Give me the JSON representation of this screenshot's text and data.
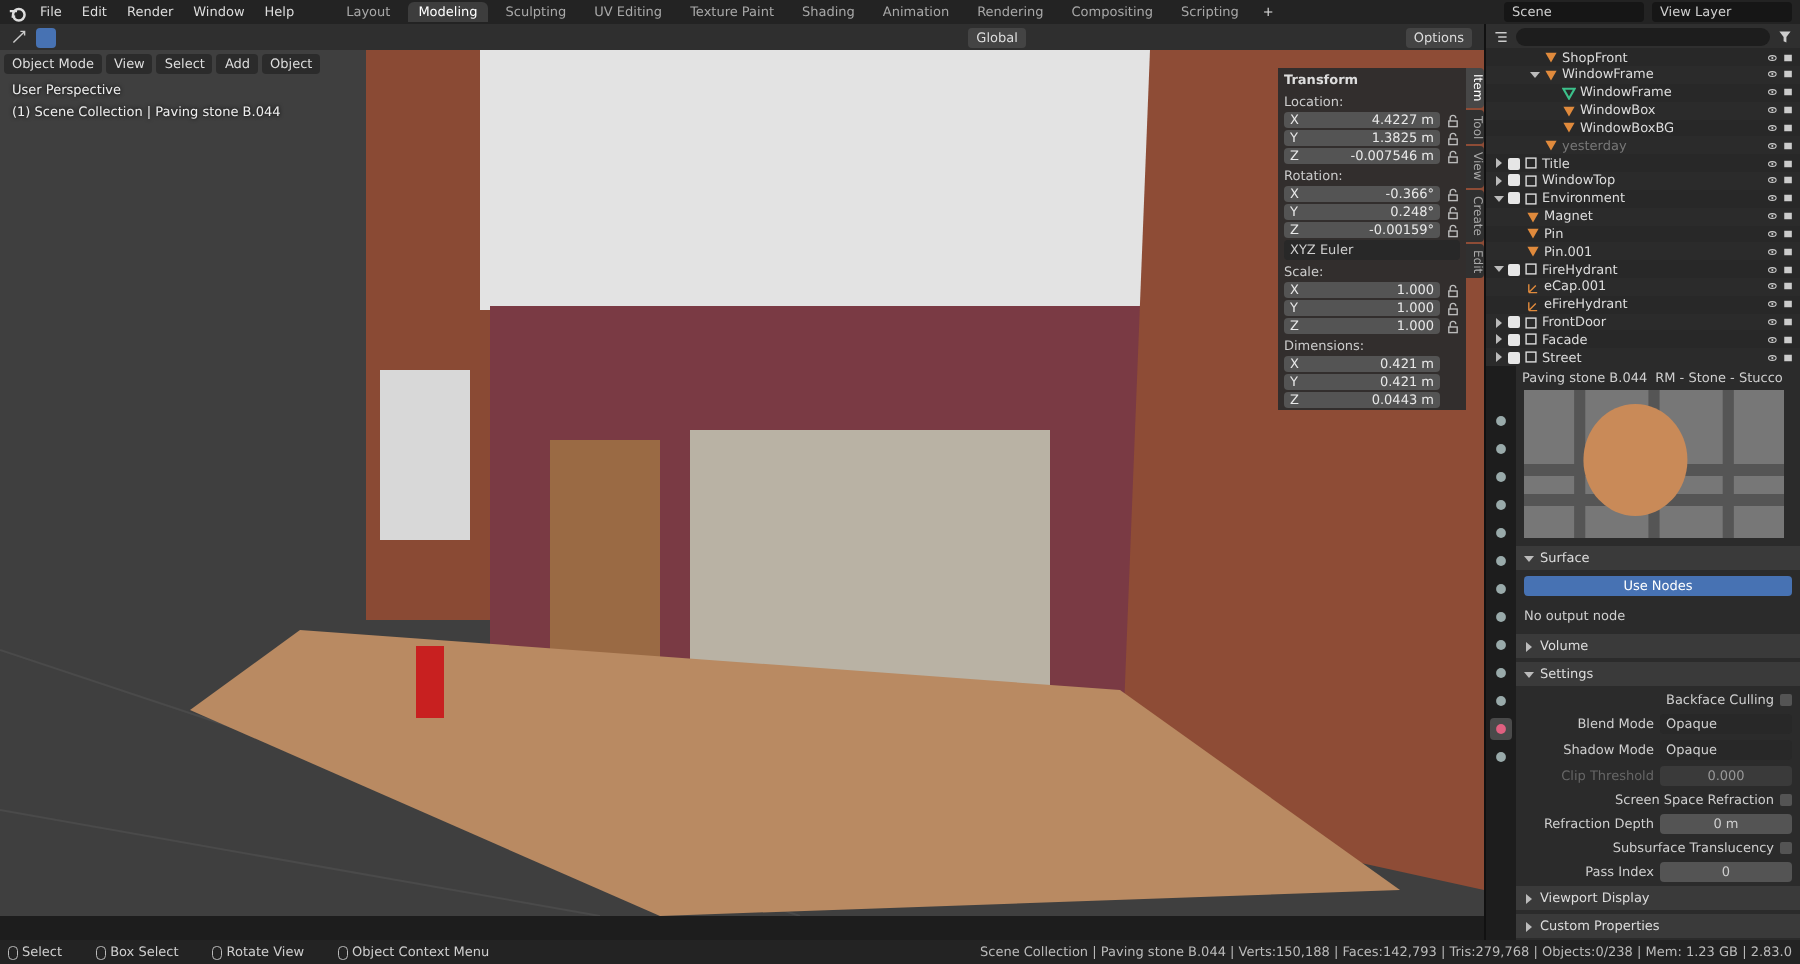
{
  "menu": [
    "File",
    "Edit",
    "Render",
    "Window",
    "Help"
  ],
  "workspaces": [
    {
      "label": "Layout",
      "selected": false
    },
    {
      "label": "Modeling",
      "selected": true
    },
    {
      "label": "Sculpting",
      "selected": false
    },
    {
      "label": "UV Editing",
      "selected": false
    },
    {
      "label": "Texture Paint",
      "selected": false
    },
    {
      "label": "Shading",
      "selected": false
    },
    {
      "label": "Animation",
      "selected": false
    },
    {
      "label": "Rendering",
      "selected": false
    },
    {
      "label": "Compositing",
      "selected": false
    },
    {
      "label": "Scripting",
      "selected": false
    }
  ],
  "add_workspace": "+",
  "scene": "Scene",
  "view_layer": "View Layer",
  "tool_header": {
    "orientation": "Global",
    "options": "Options"
  },
  "viewport": {
    "mode": "Object Mode",
    "menus": [
      "View",
      "Select",
      "Add",
      "Object"
    ],
    "info": [
      "User Perspective",
      "(1) Scene Collection | Paving stone B.044"
    ]
  },
  "sidebar": {
    "tabs": [
      {
        "label": "Item",
        "selected": true
      },
      {
        "label": "Tool",
        "selected": false
      },
      {
        "label": "View",
        "selected": false
      },
      {
        "label": "Create",
        "selected": false
      },
      {
        "label": "Edit",
        "selected": false
      }
    ],
    "title": "Transform",
    "groups": [
      {
        "label": "Location:",
        "fields": [
          {
            "axis": "X",
            "value": "4.4227 m"
          },
          {
            "axis": "Y",
            "value": "1.3825 m"
          },
          {
            "axis": "Z",
            "value": "-0.007546 m"
          }
        ],
        "locks": true
      },
      {
        "label": "Rotation:",
        "fields": [
          {
            "axis": "X",
            "value": "-0.366°"
          },
          {
            "axis": "Y",
            "value": "0.248°"
          },
          {
            "axis": "Z",
            "value": "-0.00159°"
          }
        ],
        "locks": true,
        "mode": "XYZ Euler"
      },
      {
        "label": "Scale:",
        "fields": [
          {
            "axis": "X",
            "value": "1.000"
          },
          {
            "axis": "Y",
            "value": "1.000"
          },
          {
            "axis": "Z",
            "value": "1.000"
          }
        ],
        "locks": true
      },
      {
        "label": "Dimensions:",
        "fields": [
          {
            "axis": "X",
            "value": "0.421 m"
          },
          {
            "axis": "Y",
            "value": "0.421 m"
          },
          {
            "axis": "Z",
            "value": "0.0443 m"
          }
        ],
        "locks": false
      }
    ]
  },
  "outliner": {
    "continued_children": [
      {
        "label": "ShopFront",
        "kind": "object",
        "disabled": false
      },
      {
        "label": "WindowFrame",
        "kind": "object",
        "expanded": true,
        "disabled": false,
        "children": [
          {
            "label": "WindowFrame",
            "kind": "mesh",
            "disabled": false
          },
          {
            "label": "WindowBox",
            "kind": "object",
            "disabled": false
          },
          {
            "label": "WindowBoxBG",
            "kind": "object",
            "disabled": false
          }
        ]
      },
      {
        "label": "yesterday",
        "kind": "object",
        "disabled": true
      }
    ],
    "items": [
      {
        "label": "Title",
        "kind": "collection",
        "checked": true,
        "expanded": false,
        "disabled": false
      },
      {
        "label": "WindowTop",
        "kind": "collection",
        "checked": true,
        "expanded": false,
        "disabled": false
      },
      {
        "label": "Environment",
        "kind": "collection",
        "checked": true,
        "expanded": true,
        "disabled": false,
        "children": [
          {
            "label": "Magnet",
            "kind": "object",
            "disabled": false
          },
          {
            "label": "Pin",
            "kind": "object",
            "disabled": false
          },
          {
            "label": "Pin.001",
            "kind": "object",
            "disabled": false
          }
        ]
      },
      {
        "label": "FireHydrant",
        "kind": "collection",
        "checked": true,
        "expanded": true,
        "disabled": false,
        "children": [
          {
            "label": "eCap.001",
            "kind": "empty",
            "disabled": false
          },
          {
            "label": "eFireHydrant",
            "kind": "empty",
            "disabled": false
          }
        ]
      },
      {
        "label": "FrontDoor",
        "kind": "collection",
        "checked": true,
        "expanded": false,
        "disabled": false
      },
      {
        "label": "Facade",
        "kind": "collection",
        "checked": true,
        "expanded": false,
        "disabled": false
      },
      {
        "label": "Street",
        "kind": "collection",
        "checked": true,
        "expanded": false,
        "disabled": false
      }
    ]
  },
  "properties": {
    "object": "Paving stone B.044",
    "material": "RM - Stone - Stucco",
    "editor_tabs": [
      {
        "selected": false
      },
      {
        "selected": false
      },
      {
        "selected": false
      },
      {
        "selected": false
      },
      {
        "selected": false
      },
      {
        "selected": false
      },
      {
        "selected": false
      },
      {
        "selected": false
      },
      {
        "selected": false
      },
      {
        "selected": false
      },
      {
        "selected": false
      },
      {
        "selected": true
      },
      {
        "selected": false
      }
    ],
    "panels": [
      {
        "title": "Surface",
        "expanded": true,
        "rows": [
          {
            "kind": "button",
            "label": "Use Nodes"
          },
          {
            "kind": "note",
            "text": "No output node"
          }
        ]
      },
      {
        "title": "Volume",
        "expanded": false
      },
      {
        "title": "Settings",
        "expanded": true,
        "rows": [
          {
            "kind": "checkbox",
            "label": "Backface Culling",
            "checked": false
          },
          {
            "kind": "dropdown",
            "label": "Blend Mode",
            "value": "Opaque"
          },
          {
            "kind": "dropdown",
            "label": "Shadow Mode",
            "value": "Opaque"
          },
          {
            "kind": "number",
            "label": "Clip Threshold",
            "value": "0.000",
            "disabled": true
          },
          {
            "kind": "checkbox",
            "label": "Screen Space Refraction",
            "checked": false
          },
          {
            "kind": "number",
            "label": "Refraction Depth",
            "value": "0 m",
            "disabled": false
          },
          {
            "kind": "checkbox",
            "label": "Subsurface Translucency",
            "checked": false
          },
          {
            "kind": "number",
            "label": "Pass Index",
            "value": "0",
            "disabled": false
          }
        ]
      },
      {
        "title": "Viewport Display",
        "expanded": false
      },
      {
        "title": "Custom Properties",
        "expanded": false
      }
    ]
  },
  "status_bar": {
    "hints": [
      "Select",
      "Box Select",
      "Rotate View",
      "Object Context Menu"
    ],
    "stats": "Scene Collection | Paving stone B.044 | Verts:150,188 | Faces:142,793 | Tris:279,768 | Objects:0/238 | Mem: 1.23 GB | 2.83.0"
  }
}
